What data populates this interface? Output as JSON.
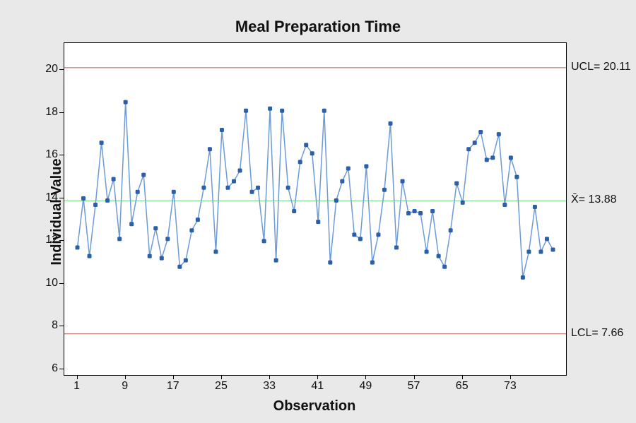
{
  "chart_data": {
    "type": "line",
    "title": "Meal Preparation Time",
    "xlabel": "Observation",
    "ylabel": "Individual Value",
    "ylim": [
      6,
      21
    ],
    "xlim": [
      0,
      81
    ],
    "y_ticks": [
      6,
      8,
      10,
      12,
      14,
      16,
      18,
      20
    ],
    "x_ticks": [
      1,
      9,
      17,
      25,
      33,
      41,
      49,
      57,
      65,
      73
    ],
    "ucl": 20.11,
    "lcl": 7.66,
    "mean": 13.88,
    "ucl_label": "UCL= 20.11",
    "lcl_label": "LCL= 7.66",
    "mean_label": "X̄= 13.88",
    "point_color": "#2B5FA8",
    "line_color": "#6C9BD6",
    "ucl_color": "#C15A53",
    "lcl_color": "#C15A53",
    "mean_color": "#7FCF8D",
    "x": [
      1,
      2,
      3,
      4,
      5,
      6,
      7,
      8,
      9,
      10,
      11,
      12,
      13,
      14,
      15,
      16,
      17,
      18,
      19,
      20,
      21,
      22,
      23,
      24,
      25,
      26,
      27,
      28,
      29,
      30,
      31,
      32,
      33,
      34,
      35,
      36,
      37,
      38,
      39,
      40,
      41,
      42,
      43,
      44,
      45,
      46,
      47,
      48,
      49,
      50,
      51,
      52,
      53,
      54,
      55,
      56,
      57,
      58,
      59,
      60,
      61,
      62,
      63,
      64,
      65,
      66,
      67,
      68,
      69,
      70,
      71,
      72,
      73,
      74,
      75,
      76,
      77,
      78,
      79,
      80
    ],
    "values": [
      11.7,
      14.0,
      11.3,
      13.7,
      16.6,
      13.9,
      14.9,
      12.1,
      18.5,
      12.8,
      14.3,
      15.1,
      11.3,
      12.6,
      11.2,
      12.1,
      14.3,
      10.8,
      11.1,
      12.5,
      13.0,
      14.5,
      16.3,
      11.5,
      17.2,
      14.5,
      14.8,
      15.3,
      18.1,
      14.3,
      14.5,
      12.0,
      18.2,
      11.1,
      18.1,
      14.5,
      13.4,
      15.7,
      16.5,
      16.1,
      12.9,
      18.1,
      11.0,
      13.9,
      14.8,
      15.4,
      12.3,
      12.1,
      15.5,
      11.0,
      12.3,
      14.4,
      17.5,
      11.7,
      14.8,
      13.3,
      13.4,
      13.3,
      11.5,
      13.4,
      11.3,
      10.8,
      12.5,
      14.7,
      13.8,
      16.3,
      16.6,
      17.1,
      15.8,
      15.9,
      17.0,
      13.7,
      15.9,
      15.0,
      10.3,
      11.5,
      13.6,
      11.5,
      12.1,
      11.6
    ]
  }
}
